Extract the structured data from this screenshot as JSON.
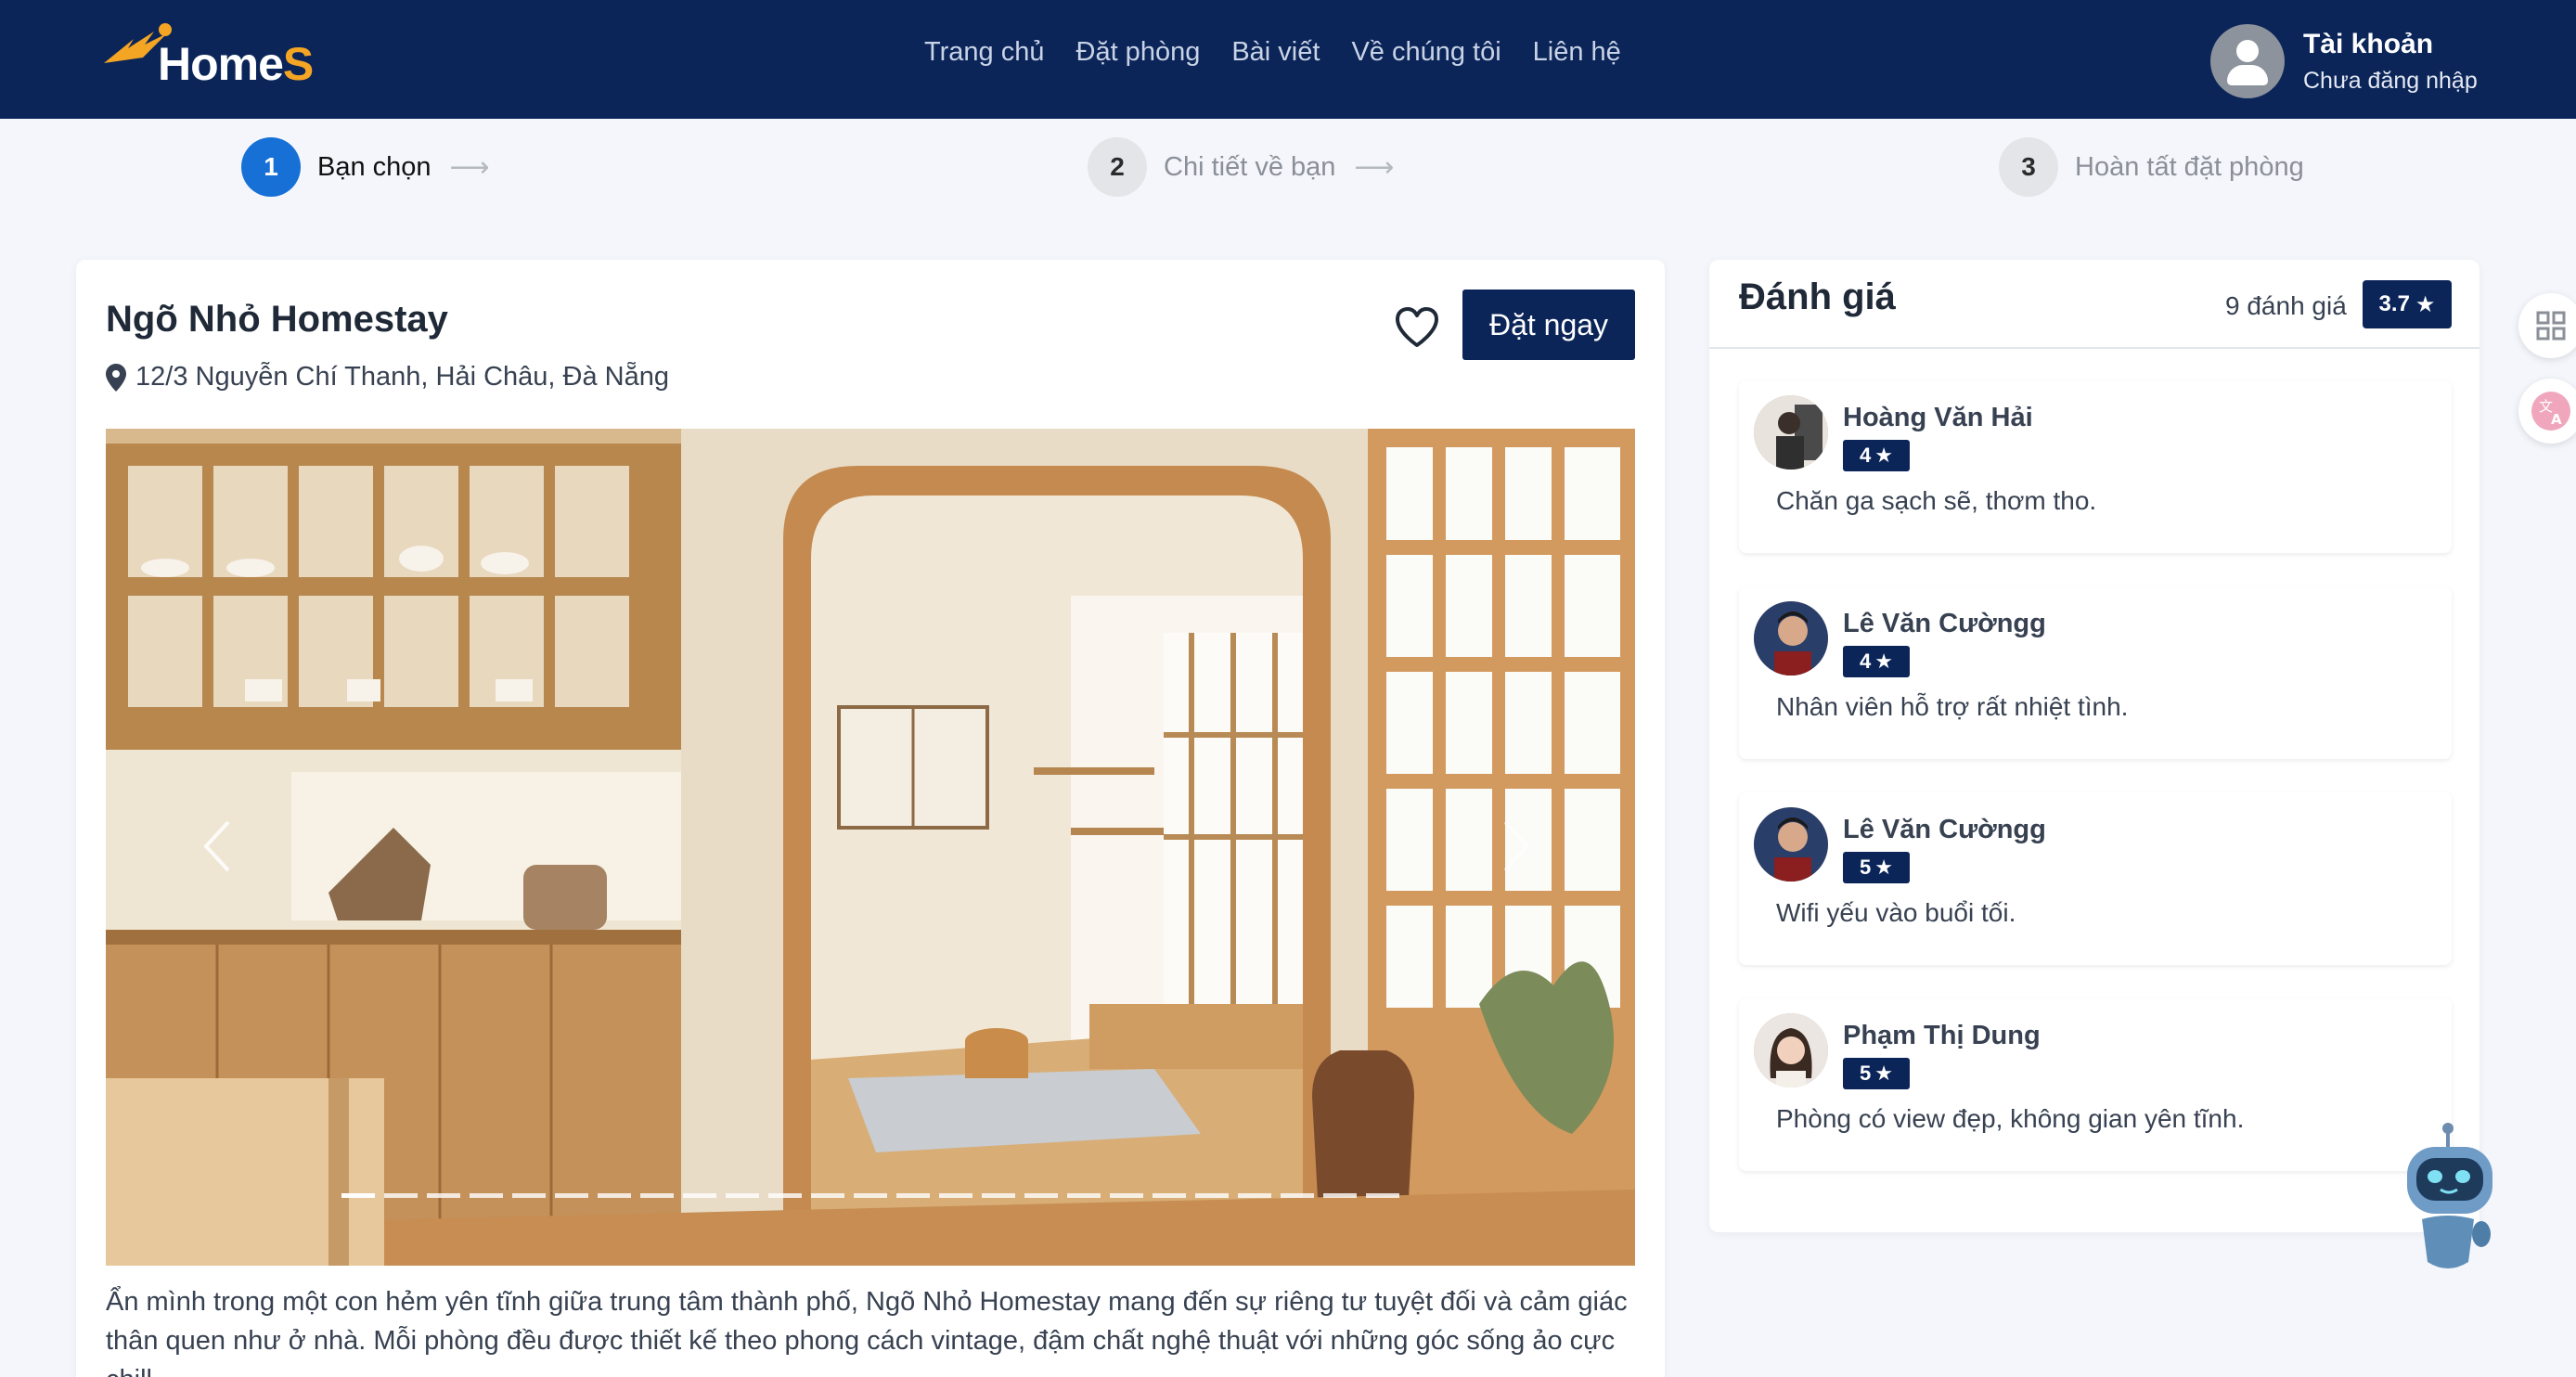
{
  "brand": {
    "name_main": "Home",
    "name_accent": "S"
  },
  "nav": {
    "items": [
      "Trang chủ",
      "Đặt phòng",
      "Bài viết",
      "Về chúng tôi",
      "Liên hệ"
    ]
  },
  "account": {
    "title": "Tài khoản",
    "status": "Chưa đăng nhập"
  },
  "steps": [
    {
      "num": "1",
      "label": "Bạn chọn",
      "active": true
    },
    {
      "num": "2",
      "label": "Chi tiết về bạn",
      "active": false
    },
    {
      "num": "3",
      "label": "Hoàn tất đặt phòng",
      "active": false
    }
  ],
  "listing": {
    "title": "Ngõ Nhỏ Homestay",
    "address": "12/3 Nguyễn Chí Thanh, Hải Châu, Đà Nẵng",
    "book_label": "Đặt ngay",
    "description": "Ẩn mình trong một con hẻm yên tĩnh giữa trung tâm thành phố, Ngõ Nhỏ Homestay mang đến sự riêng tư tuyệt đối và cảm giác thân quen như ở nhà. Mỗi phòng đều được thiết kế theo phong cách vintage, đậm chất nghệ thuật với những góc sống ảo cực chill.",
    "slide_count": 25,
    "active_slide": 1
  },
  "reviews": {
    "title": "Đánh giá",
    "count_label": "9 đánh giá",
    "average": "3.7",
    "items": [
      {
        "name": "Hoàng Văn Hải",
        "rating": "4",
        "comment": "Chăn ga sạch sẽ, thơm tho."
      },
      {
        "name": "Lê Văn Cườngg",
        "rating": "4",
        "comment": "Nhân viên hỗ trợ rất nhiệt tình."
      },
      {
        "name": "Lê Văn Cườngg",
        "rating": "5",
        "comment": "Wifi yếu vào buổi tối."
      },
      {
        "name": "Phạm Thị Dung",
        "rating": "5",
        "comment": "Phòng có view đẹp, không gian yên tĩnh."
      }
    ]
  },
  "colors": {
    "header_bg": "#0b2559",
    "accent": "#f5a524",
    "step_active": "#1670d6"
  }
}
